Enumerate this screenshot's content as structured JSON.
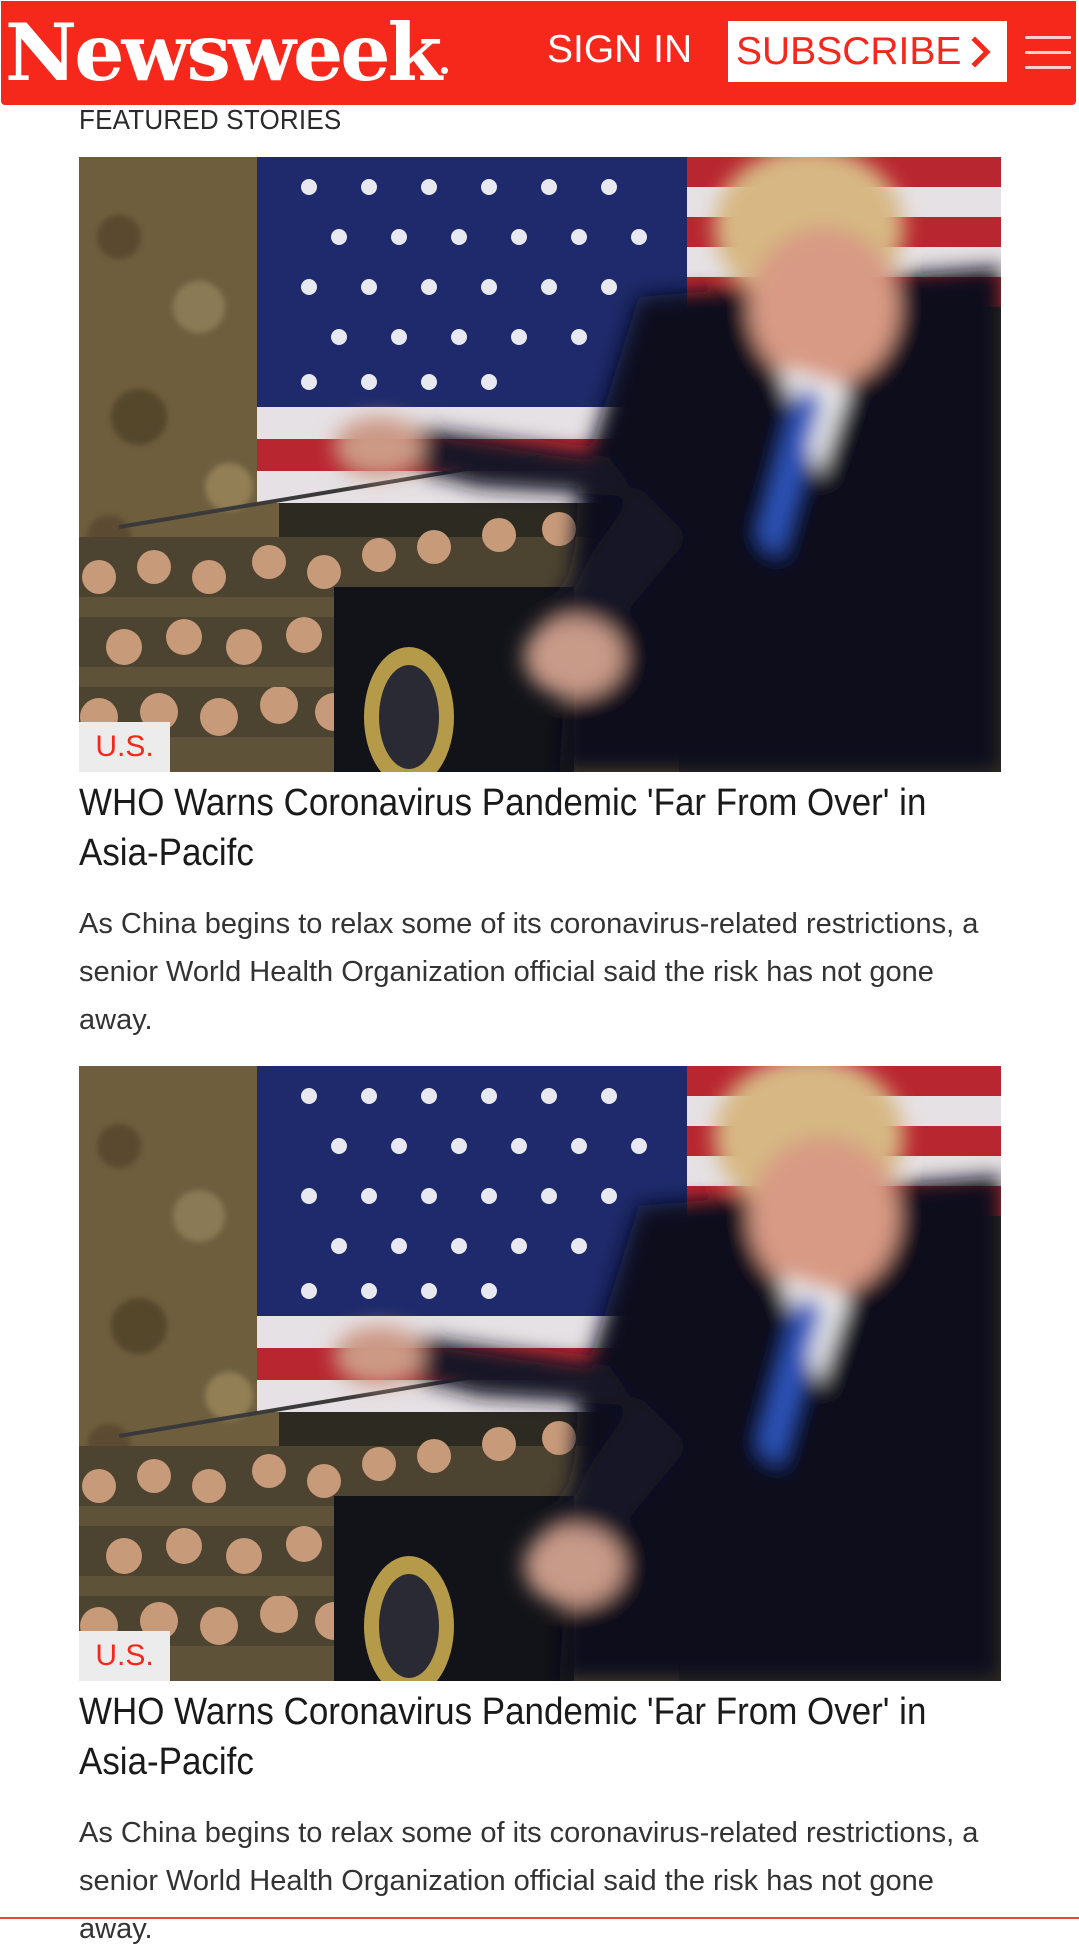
{
  "header": {
    "logo_text": "Newsweek",
    "sign_in_label": "SIGN IN",
    "subscribe_label": "SUBSCRIBE",
    "subscribe_icon": "chevron-right-icon",
    "menu_icon": "hamburger-menu-icon",
    "brand_color": "#f5281b"
  },
  "section": {
    "title": "FEATURED STORIES"
  },
  "stories": [
    {
      "category": "U.S.",
      "title": "WHO Warns Coronavirus Pandemic 'Far From Over' in Asia-Pacifc",
      "description": "As China begins to relax some of its coronavirus-related restrictions, a senior World Health Organization official said the risk has not gone away."
    },
    {
      "category": "U.S.",
      "title": "WHO Warns Coronavirus Pandemic 'Far From Over' in Asia-Pacifc",
      "description": "As China begins to relax some of its coronavirus-related restrictions, a senior World Health Organization official said the risk has not gone away."
    }
  ]
}
